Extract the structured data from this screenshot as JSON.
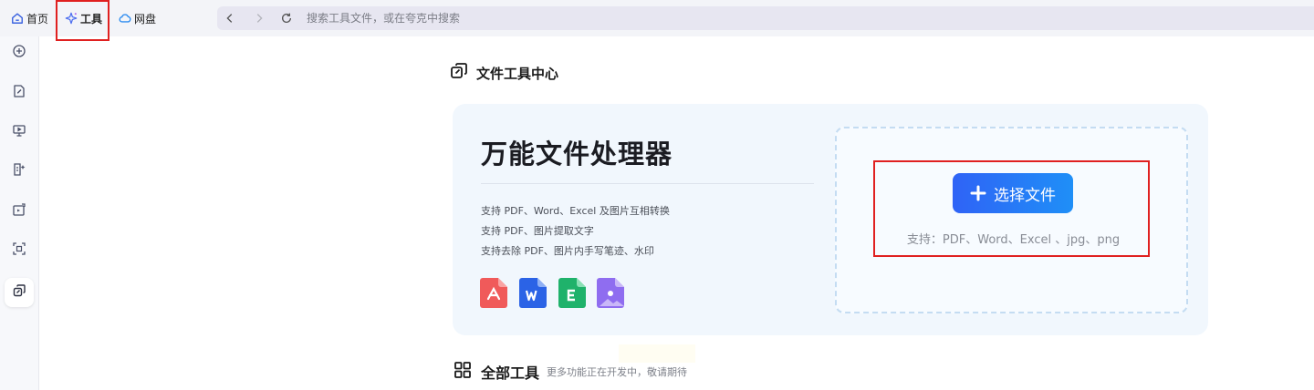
{
  "nav": {
    "tabs": [
      {
        "label": "首页",
        "icon": "home-icon"
      },
      {
        "label": "工具",
        "icon": "sparkle-icon"
      },
      {
        "label": "网盘",
        "icon": "cloud-icon"
      }
    ],
    "search_placeholder": "搜索工具文件，或在夸克中搜索"
  },
  "sidebar": {
    "items": [
      {
        "icon": "add-circle-icon"
      },
      {
        "icon": "file-edit-icon"
      },
      {
        "icon": "presentation-icon"
      },
      {
        "icon": "file-ai-icon"
      },
      {
        "icon": "image-export-icon"
      },
      {
        "icon": "scan-icon"
      },
      {
        "icon": "file-tools-icon",
        "active": true
      }
    ]
  },
  "main": {
    "section_title": "文件工具中心",
    "card": {
      "title": "万能文件处理器",
      "features": [
        "支持 PDF、Word、Excel 及图片互相转换",
        "支持 PDF、图片提取文字",
        "支持去除 PDF、图片内手写笔迹、水印"
      ],
      "format_icons": [
        {
          "name": "pdf-icon",
          "color": "#f05a5a"
        },
        {
          "name": "word-icon",
          "color": "#2b63e6"
        },
        {
          "name": "excel-icon",
          "color": "#1fb26b"
        },
        {
          "name": "image-icon",
          "color": "#8f6df0"
        }
      ],
      "choose_label": "选择文件",
      "supports": "支持：PDF、Word、Excel 、jpg、png"
    },
    "all_tools": {
      "title": "全部工具",
      "subtitle": "更多功能正在开发中，敬请期待"
    }
  },
  "colors": {
    "accent": "#2f63f6",
    "highlight": "#e02020"
  }
}
